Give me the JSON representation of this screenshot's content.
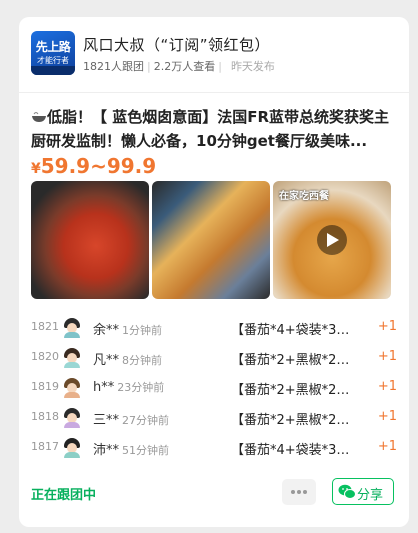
{
  "group": {
    "avatar_text_1": "先上路",
    "avatar_text_2": "才能行者",
    "name": "风口大叔（“订阅”领红包）",
    "followers": "1821人跟团",
    "views": "2.2万人查看",
    "posted": "昨天发布"
  },
  "product": {
    "title": "低脂！【 蓝色烟囱意面】法国FR蓝带总统奖获奖主厨研发监制！懒人必备，10分钟get餐厅级美味...",
    "price_symbol": "¥",
    "price_range": "59.9~99.9",
    "photo3_caption": "在家吃西餐"
  },
  "orders": [
    {
      "num": "1821",
      "user": "余**",
      "ago": "1分钟前",
      "item": "【番茄*4+袋装*3…",
      "qty": "+1",
      "hair": "#2b2b2b",
      "body": "#7fc3c9"
    },
    {
      "num": "1820",
      "user": "凡**",
      "ago": "8分钟前",
      "item": "【番茄*2+黑椒*2…",
      "qty": "+1",
      "hair": "#3a2a20",
      "body": "#9ad7d4"
    },
    {
      "num": "1819",
      "user": "h**",
      "ago": "23分钟前",
      "item": "【番茄*2+黑椒*2…",
      "qty": "+1",
      "hair": "#6b4a2a",
      "body": "#e8b08a"
    },
    {
      "num": "1818",
      "user": "三**",
      "ago": "27分钟前",
      "item": "【番茄*2+黑椒*2…",
      "qty": "+1",
      "hair": "#2a2a2a",
      "body": "#c9a9e0"
    },
    {
      "num": "1817",
      "user": "沛**",
      "ago": "51分钟前",
      "item": "【番茄*4+袋装*3…",
      "qty": "+1",
      "hair": "#222222",
      "body": "#8ccfc6"
    }
  ],
  "footer": {
    "status": "正在跟团中",
    "share_label": "分享"
  },
  "colors": {
    "accent_orange": "#f07630",
    "wechat_green": "#07c160"
  }
}
